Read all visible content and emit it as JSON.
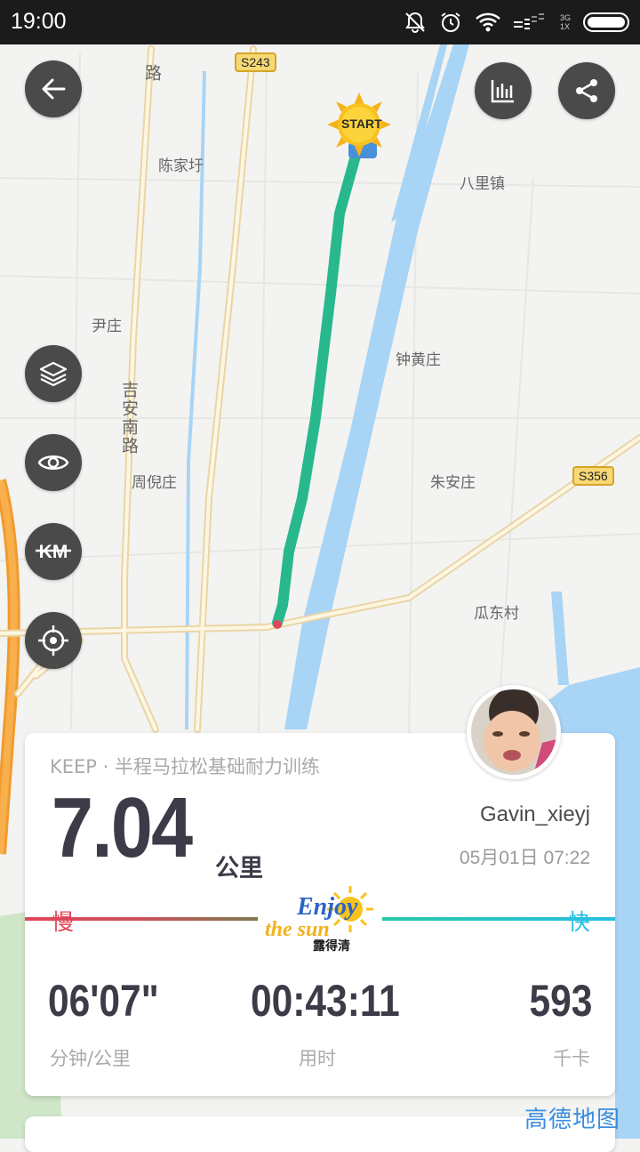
{
  "status_bar": {
    "time": "19:00",
    "network_type": "3G",
    "network_sub": "1X"
  },
  "map": {
    "labels": {
      "chenjiawei": "陈家圩",
      "balizhen": "八里镇",
      "yinzhuang": "尹庄",
      "zhonghuangzhuang": "钟黄庄",
      "zhouni": "周倪庄",
      "zhuanzhuang": "朱安庄",
      "guadong": "瓜东村",
      "road_top": "路",
      "ji_an_nan_lu": "吉安南路"
    },
    "shields": {
      "s243": "S243",
      "s356": "S356"
    },
    "start_marker": "START",
    "brand": "高德地图"
  },
  "controls": {
    "back": "back-icon",
    "stats": "bar-chart-icon",
    "share": "share-icon",
    "layers": "layers-icon",
    "eye": "eye-icon",
    "km_toggle": "KM",
    "locate": "crosshair-icon"
  },
  "summary": {
    "subtitle": "KEEP · 半程马拉松基础耐力训练",
    "distance": "7.04",
    "distance_unit": "公里",
    "username": "Gavin_xieyj",
    "datetime": "05月01日 07:22",
    "slow_label": "慢",
    "fast_label": "快",
    "logo_line1": "Enjoy",
    "logo_line2": "the sun",
    "logo_brand": "露得清",
    "pace": "06'07\"",
    "pace_label": "分钟/公里",
    "duration": "00:43:11",
    "duration_label": "用时",
    "calories": "593",
    "calories_label": "千卡"
  },
  "colors": {
    "route": "#28b88c",
    "slow": "#e0465a",
    "fast": "#27c0e3",
    "text_dark": "#3d3b47",
    "water": "#a8d4f5"
  }
}
